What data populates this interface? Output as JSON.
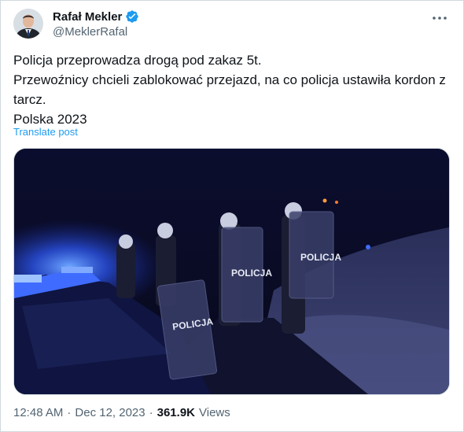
{
  "author": {
    "name": "Rafał Mekler",
    "handle": "@MeklerRafal",
    "verified_color": "#1d9bf0"
  },
  "post": {
    "lines": [
      "Policja przeprowadza drogą pod zakaz 5t.",
      "Przewoźnicy chcieli zablokować przejazd, na co policja ustawiła kordon z",
      "tarcz.",
      "Polska 2023"
    ],
    "translate_label": "Translate post",
    "media_shield_text": "POLICJA"
  },
  "meta": {
    "time": "12:48 AM",
    "separator": "·",
    "date": "Dec 12, 2023",
    "views_count": "361.9K",
    "views_label": "Views"
  },
  "icons": {
    "verified": "verified-badge-icon",
    "more": "more-options-icon"
  }
}
